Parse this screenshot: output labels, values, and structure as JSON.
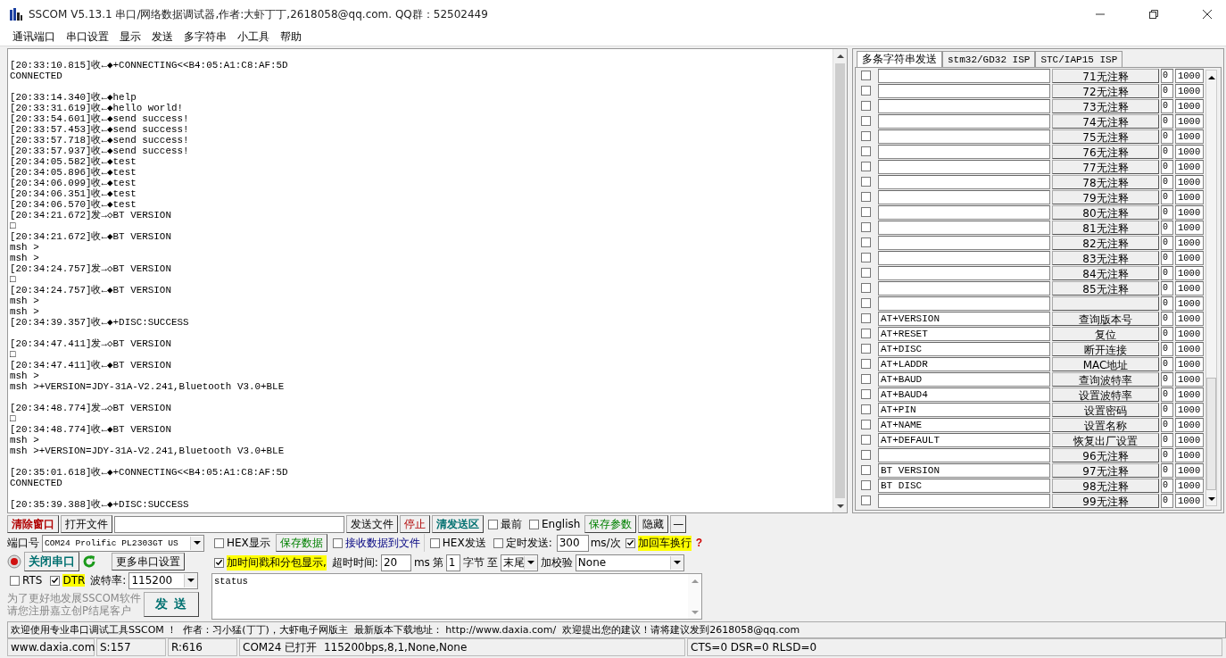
{
  "window": {
    "title": "SSCOM V5.13.1 串口/网络数据调试器,作者:大虾丁丁,2618058@qq.com. QQ群：52502449"
  },
  "menu": [
    "通讯端口",
    "串口设置",
    "显示",
    "发送",
    "多字符串",
    "小工具",
    "帮助"
  ],
  "log": {
    "blocks": [
      {
        "lines": [
          "[20:33:10.815]收←◆+CONNECTING<<B4:05:A1:C8:AF:5D",
          "CONNECTED"
        ]
      },
      {
        "lines": [
          "[20:33:14.340]收←◆help",
          "[20:33:31.619]收←◆hello world!",
          "[20:33:54.601]收←◆send success!",
          "[20:33:57.453]收←◆send success!",
          "[20:33:57.718]收←◆send success!",
          "[20:33:57.937]收←◆send success!",
          "[20:34:05.582]收←◆test",
          "[20:34:05.896]收←◆test",
          "[20:34:06.099]收←◆test",
          "[20:34:06.351]收←◆test",
          "[20:34:06.570]收←◆test",
          "[20:34:21.672]发→◇BT VERSION",
          "□",
          "[20:34:21.672]收←◆BT VERSION",
          "msh >",
          "msh >",
          "[20:34:24.757]发→◇BT VERSION",
          "□",
          "[20:34:24.757]收←◆BT VERSION",
          "msh >",
          "msh >",
          "[20:34:39.357]收←◆+DISC:SUCCESS"
        ]
      },
      {
        "lines": [
          "[20:34:47.411]发→◇BT VERSION",
          "□",
          "[20:34:47.411]收←◆BT VERSION",
          "msh >",
          "msh >+VERSION=JDY-31A-V2.241,Bluetooth V3.0+BLE"
        ]
      },
      {
        "lines": [
          "[20:34:48.774]发→◇BT VERSION",
          "□",
          "[20:34:48.774]收←◆BT VERSION",
          "msh >",
          "msh >+VERSION=JDY-31A-V2.241,Bluetooth V3.0+BLE"
        ]
      },
      {
        "lines": [
          "[20:35:01.618]收←◆+CONNECTING<<B4:05:A1:C8:AF:5D",
          "CONNECTED"
        ]
      },
      {
        "lines": [
          "[20:35:39.388]收←◆+DISC:SUCCESS"
        ]
      }
    ]
  },
  "multi_send": {
    "tabs": [
      {
        "label": "多条字符串发送",
        "selected": true
      },
      {
        "label": "stm32/GD32 ISP",
        "selected": false
      },
      {
        "label": "STC/IAP15 ISP",
        "selected": false
      }
    ],
    "rows": [
      {
        "checked": false,
        "label": "71无注释",
        "order": "0",
        "delay": "1000"
      },
      {
        "checked": false,
        "label": "72无注释",
        "order": "0",
        "delay": "1000"
      },
      {
        "checked": false,
        "label": "73无注释",
        "order": "0",
        "delay": "1000"
      },
      {
        "checked": false,
        "label": "74无注释",
        "order": "0",
        "delay": "1000"
      },
      {
        "checked": false,
        "label": "75无注释",
        "order": "0",
        "delay": "1000"
      },
      {
        "checked": false,
        "label": "76无注释",
        "order": "0",
        "delay": "1000"
      },
      {
        "checked": false,
        "label": "77无注释",
        "order": "0",
        "delay": "1000"
      },
      {
        "checked": false,
        "label": "78无注释",
        "order": "0",
        "delay": "1000"
      },
      {
        "checked": false,
        "label": "79无注释",
        "order": "0",
        "delay": "1000"
      },
      {
        "checked": false,
        "label": "80无注释",
        "order": "0",
        "delay": "1000"
      },
      {
        "checked": false,
        "label": "81无注释",
        "order": "0",
        "delay": "1000"
      },
      {
        "checked": false,
        "label": "82无注释",
        "order": "0",
        "delay": "1000"
      },
      {
        "checked": false,
        "label": "83无注释",
        "order": "0",
        "delay": "1000"
      },
      {
        "checked": false,
        "label": "84无注释",
        "order": "0",
        "delay": "1000"
      },
      {
        "checked": false,
        "label": "85无注释",
        "order": "0",
        "delay": "1000"
      },
      {
        "checked": false,
        "order": "0",
        "delay": "1000"
      },
      {
        "checked": false,
        "value": "AT+VERSION",
        "label": "查询版本号",
        "order": "0",
        "delay": "1000"
      },
      {
        "checked": false,
        "value": "AT+RESET",
        "label": "复位",
        "order": "0",
        "delay": "1000"
      },
      {
        "checked": false,
        "value": "AT+DISC",
        "label": "断开连接",
        "order": "0",
        "delay": "1000"
      },
      {
        "checked": false,
        "value": "AT+LADDR",
        "label": "MAC地址",
        "order": "0",
        "delay": "1000"
      },
      {
        "checked": false,
        "value": "AT+BAUD",
        "label": "查询波特率",
        "order": "0",
        "delay": "1000"
      },
      {
        "checked": false,
        "value": "AT+BAUD4",
        "label": "设置波特率",
        "order": "0",
        "delay": "1000"
      },
      {
        "checked": false,
        "value": "AT+PIN",
        "label": "设置密码",
        "order": "0",
        "delay": "1000"
      },
      {
        "checked": false,
        "value": "AT+NAME",
        "label": "设置名称",
        "order": "0",
        "delay": "1000"
      },
      {
        "checked": false,
        "value": "AT+DEFAULT",
        "label": "恢复出厂设置",
        "order": "0",
        "delay": "1000"
      },
      {
        "checked": false,
        "label": "96无注释",
        "order": "0",
        "delay": "1000"
      },
      {
        "checked": false,
        "value": "BT VERSION",
        "label": "97无注释",
        "order": "0",
        "delay": "1000"
      },
      {
        "checked": false,
        "value": "BT DISC",
        "label": "98无注释",
        "order": "0",
        "delay": "1000"
      },
      {
        "checked": false,
        "label": "99无注释",
        "order": "0",
        "delay": "1000"
      }
    ]
  },
  "toolbar": {
    "clear_button": "清除窗口",
    "open_file_button": "打开文件",
    "send_file_button": "发送文件",
    "stop_button": "停止",
    "clear_send_button": "清发送区",
    "topmost": {
      "label": "最前",
      "checked": false
    },
    "english": {
      "label": "English",
      "checked": false
    },
    "save_params_button": "保存参数",
    "hide_button": "隐藏",
    "collapse_button": "—"
  },
  "port": {
    "port_label": "端口号",
    "port_value": "COM24 Prolific PL2303GT US",
    "close_port_button": "关闭串口",
    "more_settings_button": "更多串口设置",
    "rts": {
      "label": "RTS",
      "checked": false
    },
    "dtr": {
      "label": "DTR",
      "checked": true
    },
    "baud_label": "波特率:",
    "baud_value": "115200",
    "promo": [
      "为了更好地发展SSCOM软件",
      "请您注册嘉立创P结尾客户"
    ],
    "send_button": "发 送"
  },
  "receive": {
    "hex_display": {
      "label": "HEX显示",
      "checked": false
    },
    "save_data_button": "保存数据",
    "receive_to_file": {
      "label": "接收数据到文件",
      "checked": false
    },
    "timestamp": {
      "label": "加时间戳和分包显示,",
      "checked": true
    },
    "timeout_label": "超时时间:",
    "timeout_value": "20",
    "timeout_unit": "ms",
    "byte_from_label": "第",
    "byte_from_value": "1",
    "byte_unit": "字节",
    "to_label": "至",
    "to_value": "末尾",
    "checksum_label": "加校验",
    "checksum_value": "None"
  },
  "send": {
    "hex_send": {
      "label": "HEX发送",
      "checked": false
    },
    "timed_send": {
      "label": "定时发送:",
      "checked": false
    },
    "interval_value": "300",
    "interval_unit": "ms/次",
    "append_newline": {
      "label": "加回车换行",
      "checked": true
    },
    "help": "?",
    "text": "status"
  },
  "marquee": "欢迎使用专业串口调试工具SSCOM ！  作者：习小猛(丁丁)，大虾电子网版主  最新版本下载地址： http://www.daxia.com/  欢迎提出您的建议！请将建议发到2618058@qq.com",
  "status_bar": [
    "www.daxia.com",
    "S:157",
    "R:616",
    "COM24 已打开  115200bps,8,1,None,None",
    "CTS=0 DSR=0 RLSD=0"
  ]
}
